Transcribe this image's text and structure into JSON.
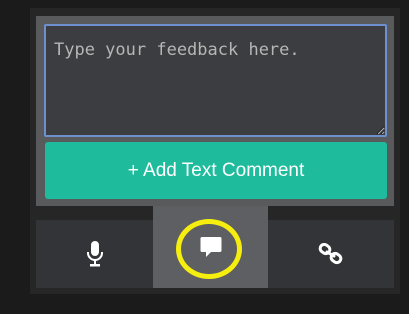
{
  "feedback": {
    "placeholder": "Type your feedback here."
  },
  "add_button": {
    "label": "+ Add Text Comment"
  },
  "tabs": [
    {
      "id": "voice",
      "icon": "microphone-icon",
      "selected": false
    },
    {
      "id": "text",
      "icon": "speech-bubble-icon",
      "selected": true
    },
    {
      "id": "link",
      "icon": "link-icon",
      "selected": false
    }
  ],
  "colors": {
    "accent": "#1ebc9c",
    "highlight_ring": "#f5ee0e",
    "input_border": "#6e8fd0"
  }
}
